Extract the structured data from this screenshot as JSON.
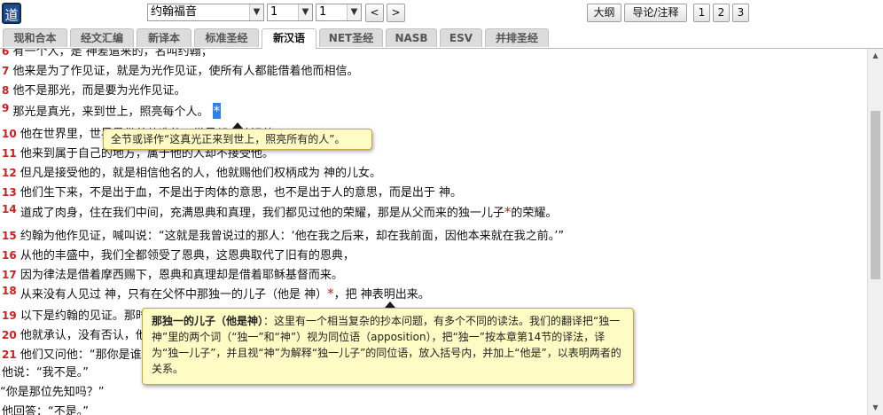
{
  "app": {
    "logo_char": "道"
  },
  "toolbar": {
    "book": "约翰福音",
    "chapter": "1",
    "verse": "1",
    "prev": "<",
    "next": ">",
    "outline": "大纲",
    "intro": "导论/注释",
    "size_options": [
      "1",
      "2",
      "3"
    ]
  },
  "tabs": [
    "现和合本",
    "经文汇编",
    "新译本",
    "标准圣经",
    "新汉语",
    "NET圣经",
    "NASB",
    "ESV",
    "并排圣经"
  ],
  "active_tab": "新汉语",
  "verses": [
    {
      "num": "6",
      "text": "有一个人，是  神差遣来的，名叫约翰；"
    },
    {
      "num": "7",
      "text": "他来是为了作见证，就是为光作见证，使所有人都能借着他而相信。"
    },
    {
      "num": "8",
      "text": "他不是那光，而是要为光作见证。"
    },
    {
      "num": "9",
      "text": "那光是真光，来到世上，照亮每个人。",
      "star": "*"
    },
    {
      "num": "10",
      "text": "他在世界里，世界是借着他造的，世界却不认识他。"
    },
    {
      "num": "11",
      "text": "他来到属于自己的地方，属于他的人却不接受他。"
    },
    {
      "num": "12",
      "text": "但凡是接受他的，就是相信他名的人，他就赐他们权柄成为  神的儿女。"
    },
    {
      "num": "13",
      "text": "他们生下来，不是出于血，不是出于肉体的意思，也不是出于人的意思，而是出于  神。"
    },
    {
      "num": "14",
      "text": "道成了肉身，住在我们中间，充满恩典和真理，我们都见过他的荣耀，那是从父而来的独一儿子",
      "star": "*",
      "after": "的荣耀。"
    },
    {
      "num": "15",
      "text": "约翰为他作见证，喊叫说：“这就是我曾说过的那人：‘他在我之后来，却在我前面，因他本来就在我之前。’”"
    },
    {
      "num": "16",
      "text": "从他的丰盛中，我们全都领受了恩典，这恩典取代了旧有的恩典，"
    },
    {
      "num": "17",
      "text": "因为律法是借着摩西赐下，恩典和真理却是借着耶稣基督而来。"
    },
    {
      "num": "18",
      "text": "从来没有人见过  神，只有在父怀中那独一的儿子（他是  神）",
      "star": "*",
      "after": "，把  神表明出来。"
    },
    {
      "num": "19",
      "text": "以下是约翰的见证。那时犹太人从耶路撒冷派祭司和利未人到约翰那里去，问他：“你是谁？”"
    },
    {
      "num": "20",
      "text": "他就承认，没有否认，他承认说：“我不是基督。”"
    },
    {
      "num": "21",
      "text": "他们又问他：“那你是谁？是以利亚吗？”"
    },
    {
      "num": "",
      "text": "他说：“我不是。”"
    },
    {
      "num": "",
      "text": "“你是那位先知吗？”"
    },
    {
      "num": "",
      "text": "他回答：“不是。”"
    }
  ],
  "tooltip_small": "全节或译作“这真光正来到世上，照亮所有的人”。",
  "tooltip_large": {
    "title": "那独一的儿子（他是神）",
    "body": "：这里有一个相当复杂的抄本问题，有多个不同的读法。我们的翻译把“独一神”里的两个词（“独一”和“神”）视为同位语（apposition），把“独一”按本章第14节的译法，译为“独一儿子”，并且视“神”为解释“独一儿子”的同位语，放入括号内，并加上“他是”，以表明两者的关系。"
  },
  "colors": {
    "verse_num": "#d41c1c",
    "highlight": "#2f80e8",
    "tooltip_bg": "#fefcc4",
    "logo_bg": "#1f4d8f"
  }
}
